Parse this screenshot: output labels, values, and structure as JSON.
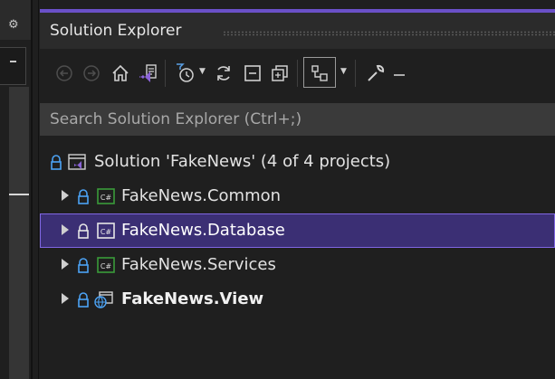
{
  "panel": {
    "title": "Solution Explorer",
    "search_placeholder": "Search Solution Explorer (Ctrl+;)"
  },
  "toolbar": {
    "items": [
      "back-icon",
      "forward-icon",
      "home-icon",
      "switch-views-icon",
      "pending-changes-filter-icon",
      "sync-icon",
      "collapse-all-icon",
      "show-all-files-icon",
      "preview-selected-icon",
      "properties-icon"
    ]
  },
  "tree": {
    "solution": "Solution 'FakeNews' (4 of 4 projects)",
    "projects": [
      {
        "label": "FakeNews.Common",
        "type": "csharp",
        "bold": false,
        "selected": false
      },
      {
        "label": "FakeNews.Database",
        "type": "csharp",
        "bold": false,
        "selected": true
      },
      {
        "label": "FakeNews.Services",
        "type": "csharp",
        "bold": false,
        "selected": false
      },
      {
        "label": "FakeNews.View",
        "type": "web",
        "bold": true,
        "selected": false
      }
    ]
  },
  "colors": {
    "accent": "#6a50c8",
    "selection": "#3b2f74",
    "csharp_icon": "#3a9b3a"
  }
}
